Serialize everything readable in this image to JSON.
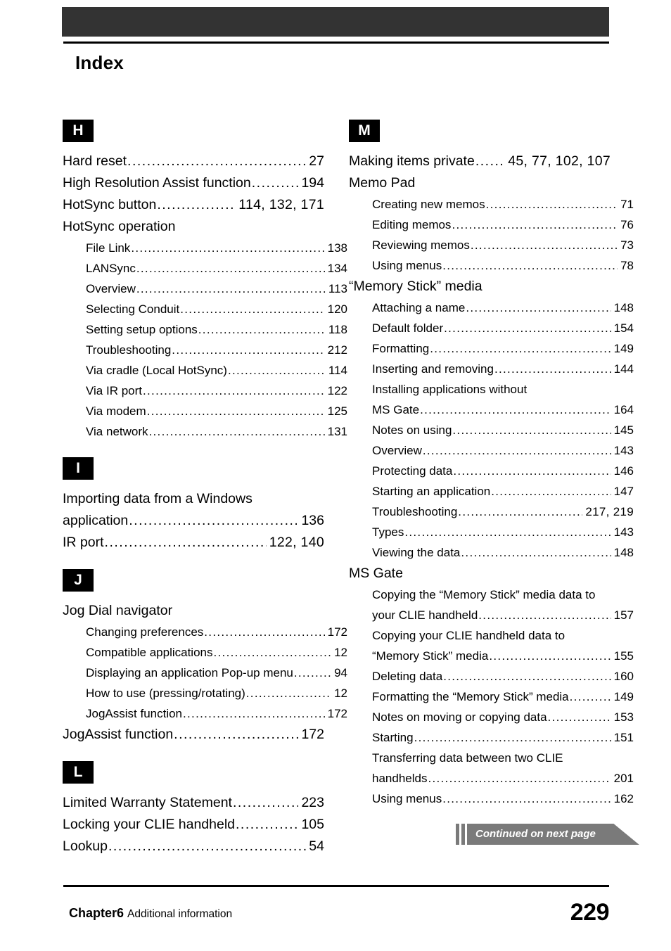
{
  "page_title": "Index",
  "colors": {
    "header_bar": "#333333",
    "letter_block": "#000000",
    "banner": "#7a7a7a",
    "text": "#000000"
  },
  "columns": {
    "left": [
      {
        "kind": "letter",
        "label": "H"
      },
      {
        "kind": "entry",
        "level": 1,
        "text": "Hard reset",
        "pages": "27"
      },
      {
        "kind": "entry",
        "level": 1,
        "text": "High Resolution Assist function",
        "pages": "194"
      },
      {
        "kind": "entry",
        "level": 1,
        "text": "HotSync button",
        "pages": "114,  132,  171"
      },
      {
        "kind": "heading",
        "level": 1,
        "text": "HotSync operation"
      },
      {
        "kind": "entry",
        "level": 2,
        "text": "File Link",
        "pages": "138"
      },
      {
        "kind": "entry",
        "level": 2,
        "text": "LANSync",
        "pages": "134"
      },
      {
        "kind": "entry",
        "level": 2,
        "text": "Overview",
        "pages": "113"
      },
      {
        "kind": "entry",
        "level": 2,
        "text": "Selecting Conduit",
        "pages": "120"
      },
      {
        "kind": "entry",
        "level": 2,
        "text": "Setting setup options",
        "pages": "118"
      },
      {
        "kind": "entry",
        "level": 2,
        "text": "Troubleshooting",
        "pages": "212"
      },
      {
        "kind": "entry",
        "level": 2,
        "text": "Via cradle (Local HotSync)",
        "pages": "114"
      },
      {
        "kind": "entry",
        "level": 2,
        "text": "Via IR port",
        "pages": "122"
      },
      {
        "kind": "entry",
        "level": 2,
        "text": "Via modem",
        "pages": "125"
      },
      {
        "kind": "entry",
        "level": 2,
        "text": "Via network",
        "pages": "131"
      },
      {
        "kind": "letter",
        "label": "I",
        "spaced": true
      },
      {
        "kind": "wrap",
        "level": 1,
        "text": "Importing data from a Windows"
      },
      {
        "kind": "entry",
        "level": 1,
        "text": "application",
        "pages": "136"
      },
      {
        "kind": "entry",
        "level": 1,
        "text": "IR port",
        "pages": "122,  140"
      },
      {
        "kind": "letter",
        "label": "J",
        "spaced": true
      },
      {
        "kind": "heading",
        "level": 1,
        "text": "Jog Dial navigator"
      },
      {
        "kind": "entry",
        "level": 2,
        "text": "Changing preferences",
        "pages": "172"
      },
      {
        "kind": "entry",
        "level": 2,
        "text": "Compatible applications",
        "pages": "12"
      },
      {
        "kind": "entry",
        "level": 2,
        "text": "Displaying an application Pop-up menu",
        "pages": "94"
      },
      {
        "kind": "entry",
        "level": 2,
        "text": "How to use (pressing/rotating)",
        "pages": "12"
      },
      {
        "kind": "entry",
        "level": 2,
        "text": "JogAssist function",
        "pages": "172"
      },
      {
        "kind": "entry",
        "level": 1,
        "text": "JogAssist function",
        "pages": "172"
      },
      {
        "kind": "letter",
        "label": "L",
        "spaced": true
      },
      {
        "kind": "entry",
        "level": 1,
        "text": "Limited Warranty Statement",
        "pages": "223"
      },
      {
        "kind": "entry",
        "level": 1,
        "text": "Locking your CLIE handheld",
        "pages": "105"
      },
      {
        "kind": "entry",
        "level": 1,
        "text": "Lookup",
        "pages": "54"
      }
    ],
    "right": [
      {
        "kind": "letter",
        "label": "M"
      },
      {
        "kind": "entry",
        "level": 1,
        "text": "Making items private",
        "pages": "45,  77,  102,  107"
      },
      {
        "kind": "heading",
        "level": 1,
        "text": "Memo Pad"
      },
      {
        "kind": "entry",
        "level": 2,
        "text": "Creating new memos",
        "pages": "71"
      },
      {
        "kind": "entry",
        "level": 2,
        "text": "Editing memos",
        "pages": "76"
      },
      {
        "kind": "entry",
        "level": 2,
        "text": "Reviewing memos",
        "pages": "73"
      },
      {
        "kind": "entry",
        "level": 2,
        "text": "Using menus",
        "pages": "78"
      },
      {
        "kind": "heading",
        "level": 1,
        "text": "“Memory Stick” media"
      },
      {
        "kind": "entry",
        "level": 2,
        "text": "Attaching a name",
        "pages": "148"
      },
      {
        "kind": "entry",
        "level": 2,
        "text": "Default folder",
        "pages": "154"
      },
      {
        "kind": "entry",
        "level": 2,
        "text": "Formatting",
        "pages": "149"
      },
      {
        "kind": "entry",
        "level": 2,
        "text": "Inserting and removing",
        "pages": "144"
      },
      {
        "kind": "wrap",
        "level": 2,
        "text": "Installing applications without"
      },
      {
        "kind": "entry",
        "level": 2,
        "text": "MS Gate",
        "pages": "164"
      },
      {
        "kind": "entry",
        "level": 2,
        "text": "Notes on using",
        "pages": "145"
      },
      {
        "kind": "entry",
        "level": 2,
        "text": "Overview",
        "pages": "143"
      },
      {
        "kind": "entry",
        "level": 2,
        "text": "Protecting data",
        "pages": "146"
      },
      {
        "kind": "entry",
        "level": 2,
        "text": "Starting an application",
        "pages": "147"
      },
      {
        "kind": "entry",
        "level": 2,
        "text": "Troubleshooting",
        "pages": "217,  219"
      },
      {
        "kind": "entry",
        "level": 2,
        "text": "Types",
        "pages": "143"
      },
      {
        "kind": "entry",
        "level": 2,
        "text": "Viewing the data",
        "pages": "148"
      },
      {
        "kind": "heading",
        "level": 1,
        "text": "MS Gate"
      },
      {
        "kind": "wrap",
        "level": 2,
        "text": "Copying the “Memory Stick” media data to"
      },
      {
        "kind": "entry",
        "level": 2,
        "text": "your CLIE handheld",
        "pages": "157"
      },
      {
        "kind": "wrap",
        "level": 2,
        "text": "Copying your CLIE handheld data to"
      },
      {
        "kind": "entry",
        "level": 2,
        "text": "“Memory Stick” media",
        "pages": "155"
      },
      {
        "kind": "entry",
        "level": 2,
        "text": "Deleting data",
        "pages": "160"
      },
      {
        "kind": "entry",
        "level": 2,
        "text": "Formatting the “Memory Stick” media",
        "pages": "149"
      },
      {
        "kind": "entry",
        "level": 2,
        "text": "Notes on moving or copying data",
        "pages": "153"
      },
      {
        "kind": "entry",
        "level": 2,
        "text": "Starting",
        "pages": "151"
      },
      {
        "kind": "wrap",
        "level": 2,
        "text": "Transferring data between two CLIE"
      },
      {
        "kind": "entry",
        "level": 2,
        "text": "handhelds",
        "pages": "201"
      },
      {
        "kind": "entry",
        "level": 2,
        "text": "Using menus",
        "pages": "162"
      }
    ]
  },
  "continued_banner": {
    "label": "Continued on next page"
  },
  "footer": {
    "chapter": "Chapter6",
    "chapter_subtitle": "Additional information",
    "page_number": "229"
  }
}
